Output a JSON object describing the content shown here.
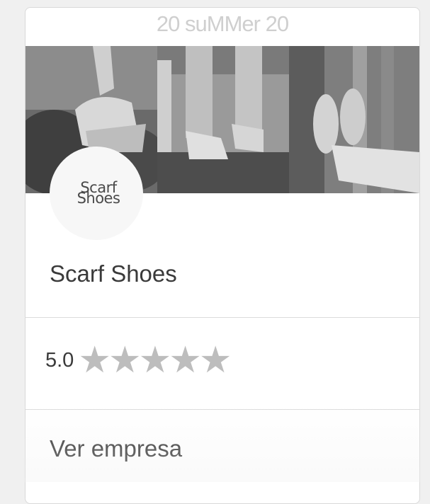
{
  "card": {
    "banner_text": "20 suMMer 20",
    "logo": {
      "line1": "Scarf",
      "line2": "Shoes"
    },
    "company_name": "Scarf Shoes",
    "rating": {
      "value": "5.0",
      "stars": 5
    },
    "link_label": "Ver empresa"
  },
  "icons": {
    "star": "star-icon"
  },
  "colors": {
    "star": "#bdbdbd",
    "text": "#3a3a3a",
    "banner_text": "#cfcfcf"
  }
}
